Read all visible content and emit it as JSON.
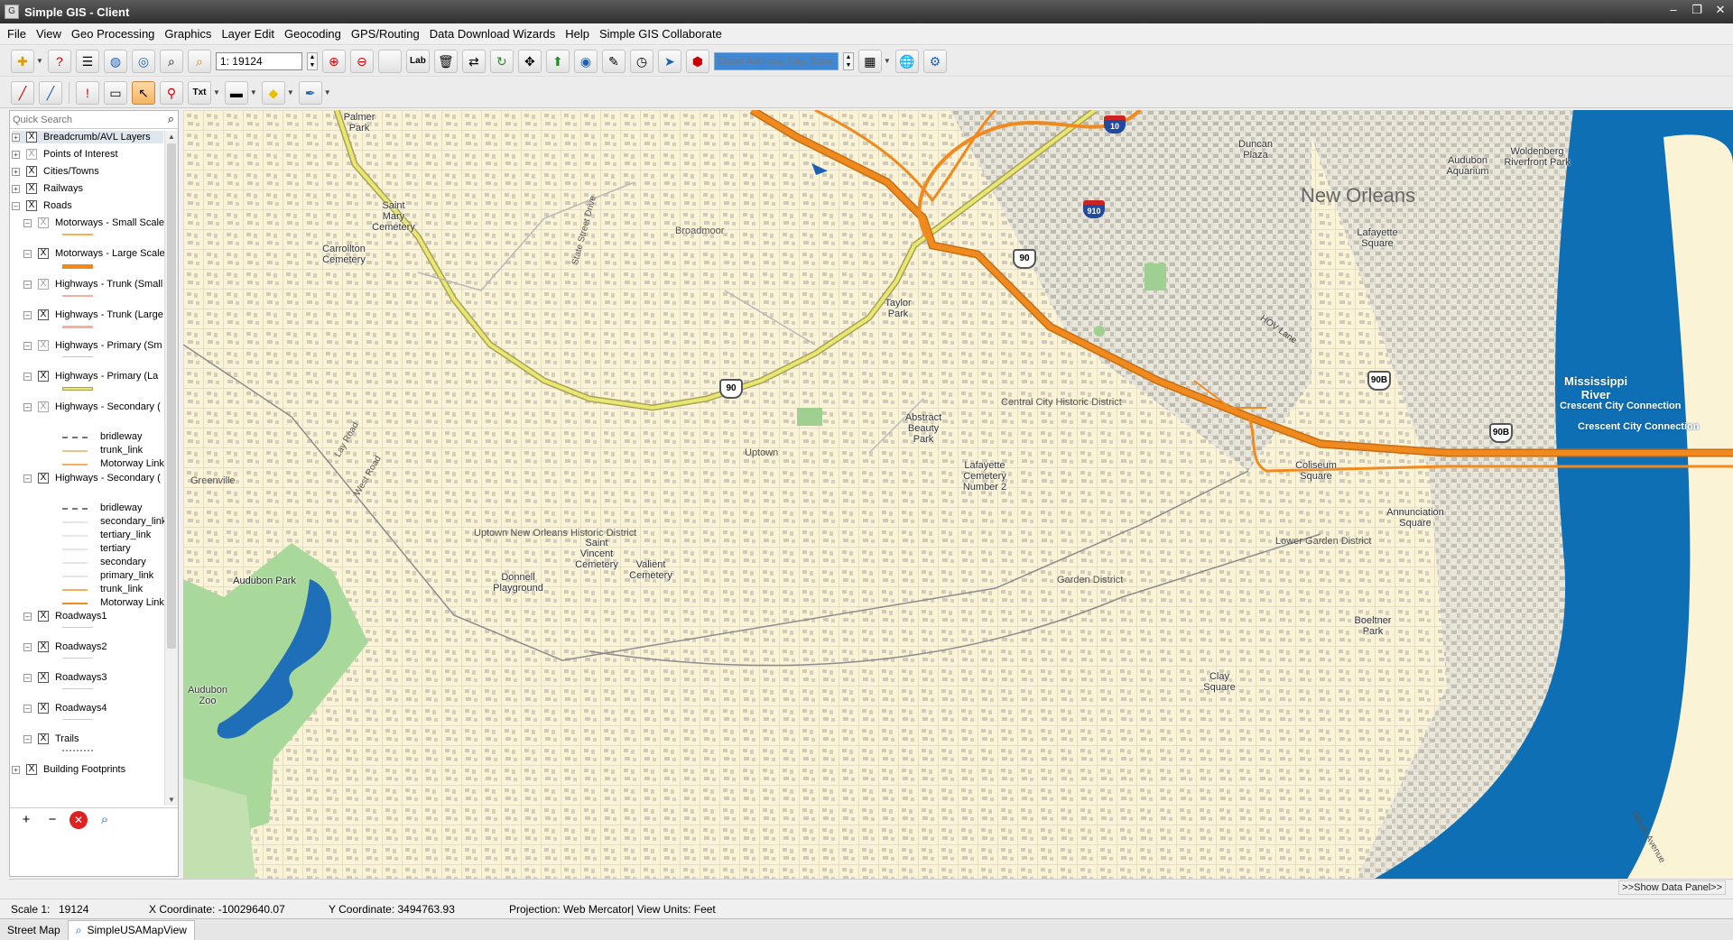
{
  "window": {
    "title": "Simple GIS - Client"
  },
  "menu": [
    "File",
    "View",
    "Geo Processing",
    "Graphics",
    "Layer Edit",
    "Geocoding",
    "GPS/Routing",
    "Data Download Wizards",
    "Help",
    "Simple GIS Collaborate"
  ],
  "toolbar": {
    "scale_value": "1: 19124",
    "address_placeholder": "Street Address, City, State"
  },
  "layers": {
    "search_placeholder": "Quick Search",
    "top": [
      {
        "label": "Breadcrumb/AVL Layers",
        "checked": true
      },
      {
        "label": "Points of Interest",
        "checked": false
      },
      {
        "label": "Cities/Towns",
        "checked": true
      },
      {
        "label": "Railways",
        "checked": true
      },
      {
        "label": "Roads",
        "checked": true
      }
    ],
    "roads_children": [
      {
        "label": "Motorways - Small Scale",
        "checked": false
      },
      {
        "label": "Motorways - Large Scale",
        "checked": true
      },
      {
        "label": "Highways - Trunk (Small",
        "checked": false
      },
      {
        "label": "Highways - Trunk (Large",
        "checked": true
      },
      {
        "label": "Highways - Primary (Sm",
        "checked": false
      },
      {
        "label": "Highways - Primary (La",
        "checked": true
      },
      {
        "label": "Highways - Secondary (",
        "checked": false
      }
    ],
    "legend_a": [
      "bridleway",
      "trunk_link",
      "Motorway Link"
    ],
    "secondary_b": {
      "label": "Highways - Secondary (",
      "checked": true
    },
    "legend_b": [
      "bridleway",
      "secondary_link",
      "tertiary_link",
      "tertiary",
      "secondary",
      "primary_link",
      "trunk_link",
      "Motorway Link"
    ],
    "roadways": [
      {
        "label": "Roadways1",
        "checked": true
      },
      {
        "label": "Roadways2",
        "checked": true
      },
      {
        "label": "Roadways3",
        "checked": true
      },
      {
        "label": "Roadways4",
        "checked": true
      },
      {
        "label": "Trails",
        "checked": true
      }
    ],
    "building": {
      "label": "Building Footprints",
      "checked": true
    }
  },
  "map": {
    "city_label": "New Orleans",
    "river_label": "Mississippi\nRiver",
    "bridge_label": "Crescent City Connection",
    "bridge_label2": "Crescent City Connection",
    "hov_label": "HOV Lane",
    "shields": {
      "i10": "10",
      "i910": "910",
      "us90a": "90",
      "us90b": "90",
      "us90b2": "90B",
      "us90b3": "90B"
    },
    "districts": [
      "Broadmoor",
      "Central City Historic District",
      "Uptown",
      "Uptown New Orleans Historic District",
      "Lower Garden District",
      "Garden District",
      "Greenville"
    ],
    "roads": [
      "State Street Drive",
      "Lay Road",
      "West Road",
      "Ocean Avenue"
    ],
    "pois": [
      "Palmer Park",
      "Saint Mary Cemetery",
      "Carrollton Cemetery",
      "Taylor Park",
      "Abstract Beauty Park",
      "Lafayette Cemetery Number 2",
      "Saint Vincent Cemetery",
      "Valient Cemetery",
      "Donnell Playground",
      "Audubon Park",
      "Audubon Zoo",
      "Duncan Plaza",
      "Audubon Aquarium",
      "Woldenberg Riverfront Park",
      "Lafayette Square",
      "Coliseum Square",
      "Annunciation Square",
      "Boeltner Park",
      "Clay Square"
    ]
  },
  "show_panel": ">>Show Data Panel>>",
  "status": {
    "scale_label": "Scale 1:",
    "scale_value": "19124",
    "x": "X Coordinate: -10029640.07",
    "y": "Y Coordinate: 3494763.93",
    "projection": "Projection: Web Mercator| View Units: Feet"
  },
  "tabs": [
    "Street Map",
    "SimpleUSAMapView"
  ],
  "colors": {
    "motorway": "#f08a1e",
    "primary": "#e8e870",
    "river": "#0f6fb5",
    "park": "#a8d89a",
    "land": "#fbf3d6"
  }
}
